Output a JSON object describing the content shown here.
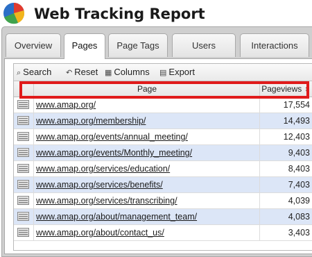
{
  "app": {
    "title": "Web Tracking Report"
  },
  "tabs": [
    {
      "label": "Overview",
      "active": false
    },
    {
      "label": "Pages",
      "active": true
    },
    {
      "label": "Page Tags",
      "active": false
    },
    {
      "label": "Users",
      "active": false
    },
    {
      "label": "Interactions",
      "active": false
    }
  ],
  "toolbar": {
    "search_label": "Search",
    "reset_label": "Reset",
    "columns_label": "Columns",
    "export_label": "Export",
    "search_icon": "search-icon",
    "reset_icon": "reset-icon",
    "columns_icon": "columns-icon",
    "export_icon": "export-icon"
  },
  "table": {
    "columns": [
      "Page",
      "Pageviews"
    ],
    "sort_indicator": "⇕",
    "highlight_color": "#e01b1b",
    "rows": [
      {
        "page": "www.amap.org/",
        "pageviews": "17,554"
      },
      {
        "page": "www.amap.org/membership/",
        "pageviews": "14,493"
      },
      {
        "page": "www.amap.org/events/annual_meeting/",
        "pageviews": "12,403"
      },
      {
        "page": "www.amap.org/events/Monthly_meeting/",
        "pageviews": "9,403"
      },
      {
        "page": "www.amap.org/services/education/",
        "pageviews": "8,403"
      },
      {
        "page": "www.amap.org/services/benefits/",
        "pageviews": "7,403"
      },
      {
        "page": "www.amap.org/services/transcribing/",
        "pageviews": "4,039"
      },
      {
        "page": "www.amap.org/about/management_team/",
        "pageviews": "4,083"
      },
      {
        "page": "www.amap.org/about/contact_us/",
        "pageviews": "3,403"
      }
    ]
  }
}
